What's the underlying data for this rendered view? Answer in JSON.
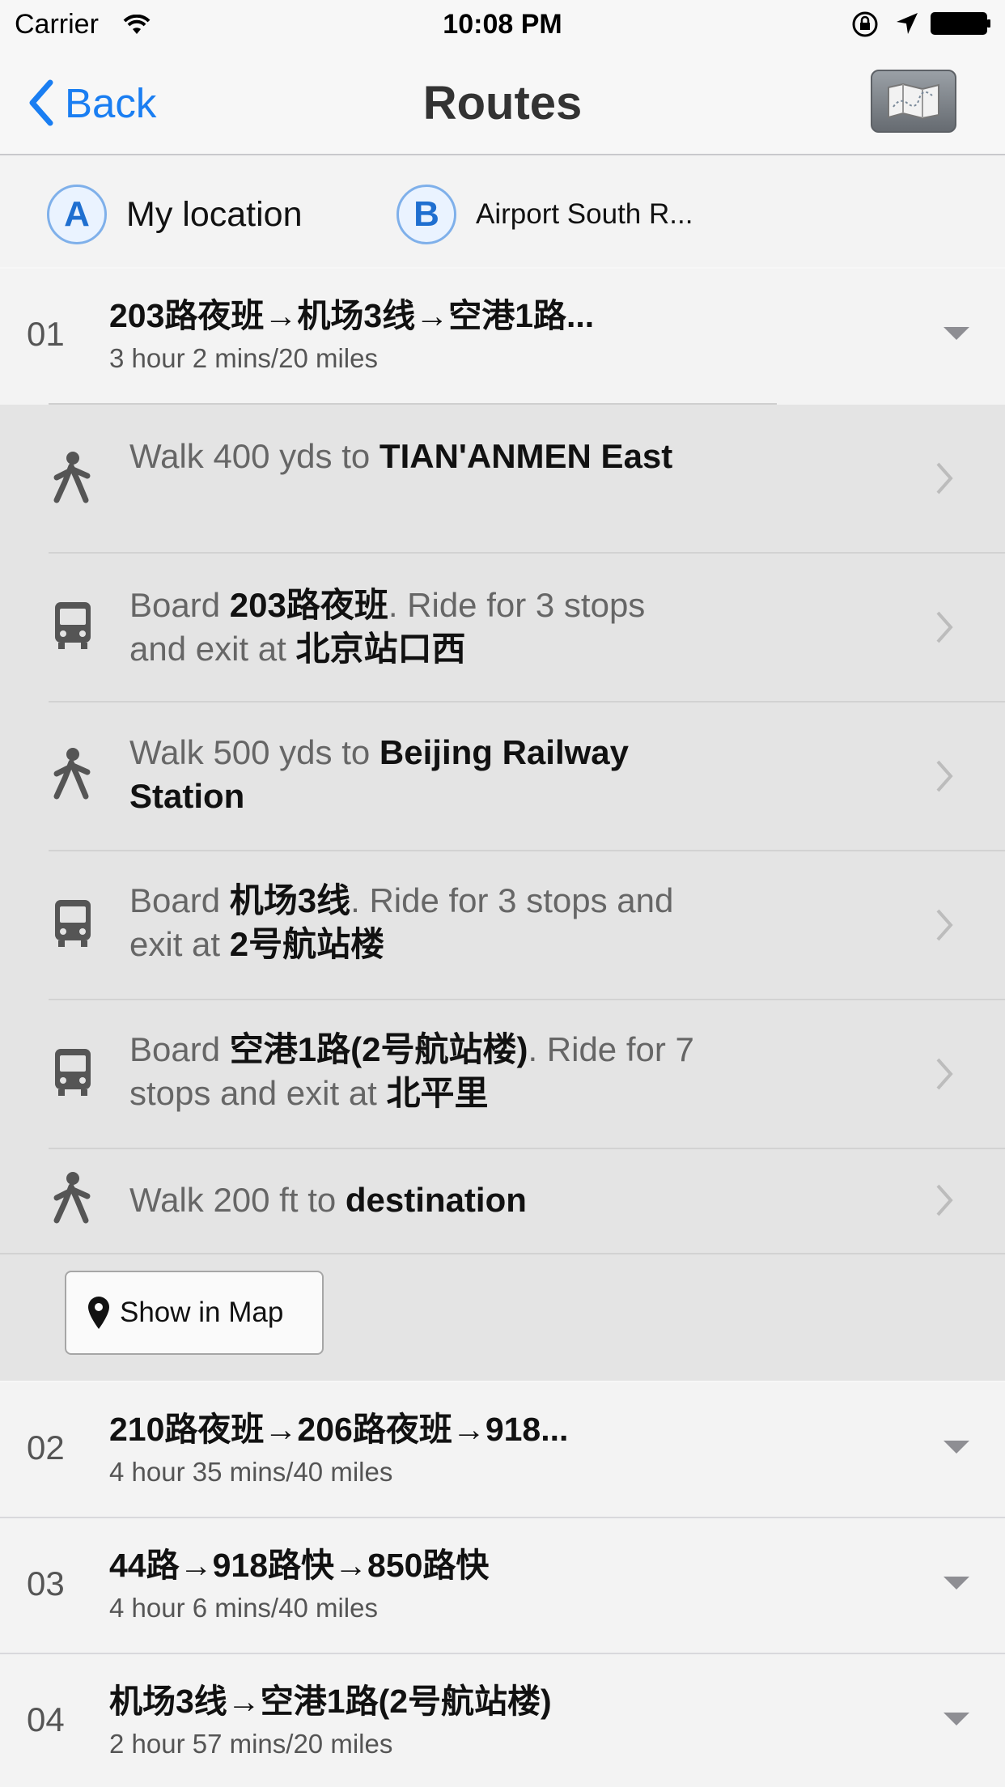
{
  "status_bar": {
    "carrier": "Carrier",
    "time": "10:08 PM",
    "icons": [
      "wifi-icon",
      "rotation-lock-icon",
      "location-arrow-icon",
      "battery-icon"
    ]
  },
  "nav": {
    "back_label": "Back",
    "title": "Routes",
    "map_button_icon": "map-icon"
  },
  "endpoints": {
    "start_badge": "A",
    "start_label": "My location",
    "end_badge": "B",
    "end_label": "Airport South R..."
  },
  "routes": [
    {
      "num": "01",
      "title": "203路夜班→机场3线→空港1路...",
      "summary": "3 hour 2 mins/20 miles",
      "expanded": true
    },
    {
      "num": "02",
      "title": "210路夜班→206路夜班→918...",
      "summary": "4 hour 35 mins/40 miles",
      "expanded": false
    },
    {
      "num": "03",
      "title": "44路→918路快→850路快",
      "summary": "4 hour 6 mins/40 miles",
      "expanded": false
    },
    {
      "num": "04",
      "title": "机场3线→空港1路(2号航站楼)",
      "summary": "2 hour 57 mins/20 miles",
      "expanded": false
    }
  ],
  "steps": [
    {
      "icon": "walk-icon",
      "parts": [
        {
          "t": "Walk 400 yds to ",
          "b": false
        },
        {
          "t": "TIAN'ANMEN East",
          "b": true
        }
      ]
    },
    {
      "icon": "bus-icon",
      "parts": [
        {
          "t": "Board ",
          "b": false
        },
        {
          "t": "203路夜班",
          "b": true
        },
        {
          "t": ". Ride for 3 stops and exit at ",
          "b": false
        },
        {
          "t": "北京站口西",
          "b": true
        }
      ]
    },
    {
      "icon": "walk-icon",
      "parts": [
        {
          "t": "Walk 500 yds to ",
          "b": false
        },
        {
          "t": "Beijing Railway Station",
          "b": true
        }
      ]
    },
    {
      "icon": "bus-icon",
      "parts": [
        {
          "t": "Board ",
          "b": false
        },
        {
          "t": "机场3线",
          "b": true
        },
        {
          "t": ". Ride for 3 stops and exit at ",
          "b": false
        },
        {
          "t": "2号航站楼",
          "b": true
        }
      ]
    },
    {
      "icon": "bus-icon",
      "parts": [
        {
          "t": "Board ",
          "b": false
        },
        {
          "t": "空港1路(2号航站楼)",
          "b": true
        },
        {
          "t": ". Ride for 7 stops and exit at ",
          "b": false
        },
        {
          "t": "北平里",
          "b": true
        }
      ]
    },
    {
      "icon": "walk-icon",
      "parts": [
        {
          "t": "Walk 200 ft to ",
          "b": false
        },
        {
          "t": "destination",
          "b": true
        }
      ]
    }
  ],
  "show_in_map": {
    "icon": "map-pin-icon",
    "label": "Show in Map"
  }
}
